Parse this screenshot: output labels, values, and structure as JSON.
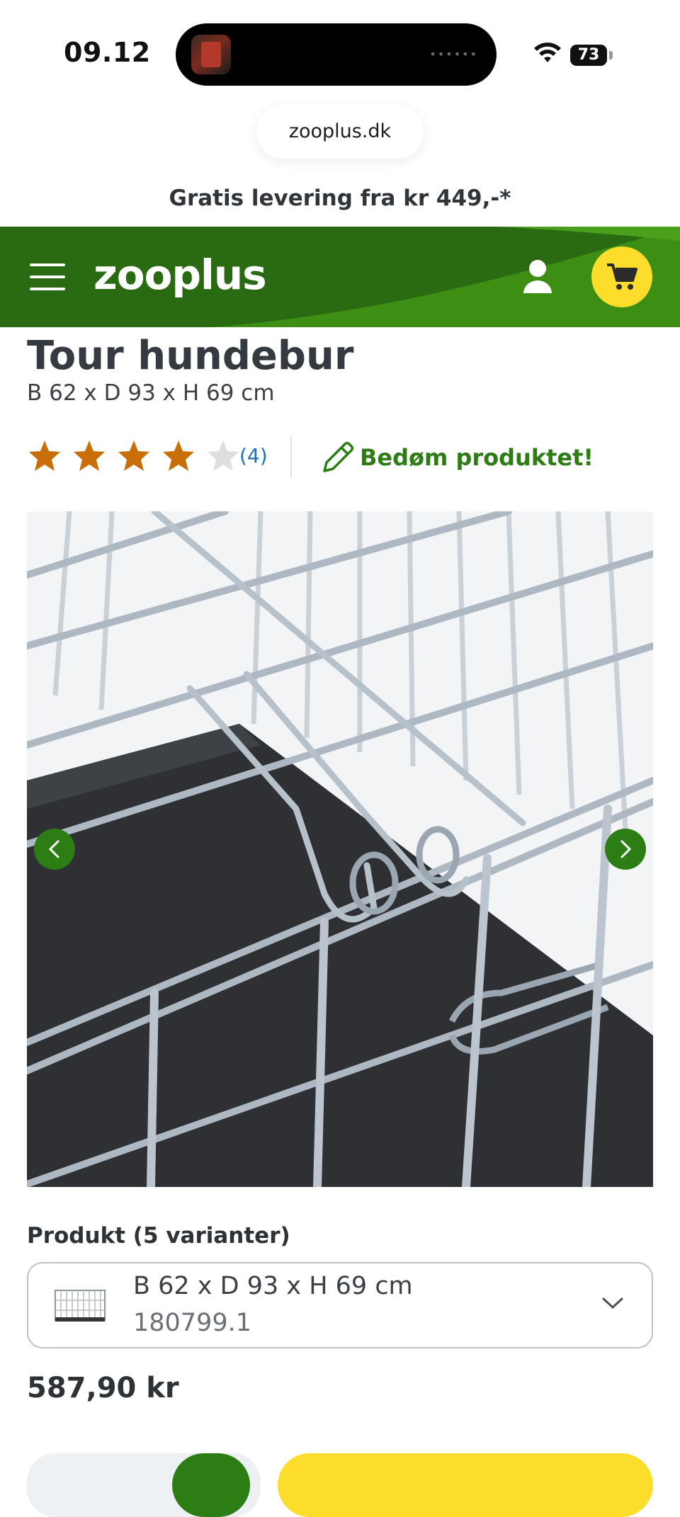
{
  "status_bar": {
    "time": "09.12",
    "battery": "73"
  },
  "browser": {
    "url": "zooplus.dk"
  },
  "promo": {
    "text": "Gratis levering fra kr 449,-*"
  },
  "header": {
    "logo": "zooplus",
    "brand_green": "#2c6e12",
    "cart_yellow": "#fddd2b"
  },
  "product": {
    "title": "Tour hundebur",
    "subtitle": "B 62 x D 93 x H 69 cm",
    "rating": {
      "stars": 4,
      "max": 5,
      "count_label": "(4)"
    },
    "rate_link": "Bedøm produktet!",
    "variants": {
      "label": "Produkt (5 varianter)",
      "selected_name": "B 62 x D 93 x H 69 cm",
      "selected_sku": "180799.1"
    },
    "price": "587,90 kr"
  },
  "colors": {
    "star_filled": "#c86f0a",
    "star_empty": "#dedede",
    "link_blue": "#1a73b8",
    "accent_green": "#2c7d14"
  }
}
